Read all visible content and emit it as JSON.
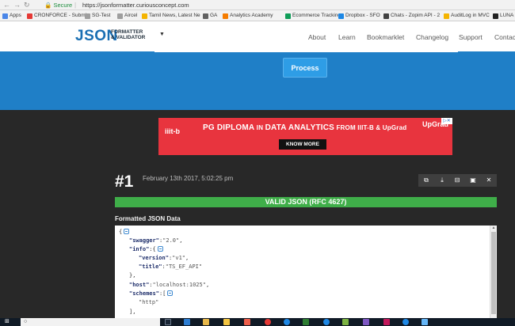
{
  "browser": {
    "secure_label": "Secure",
    "url": "https://jsonformatter.curiousconcept.com",
    "bookmarks": [
      {
        "label": "Apps",
        "color": "#4a86e8"
      },
      {
        "label": "CRONFORCE - Submi",
        "color": "#e53935"
      },
      {
        "label": "SG-Test",
        "color": "#9e9e9e"
      },
      {
        "label": "Aircel",
        "color": "#9e9e9e"
      },
      {
        "label": "Tamil News, Latest Ne",
        "color": "#f4b400"
      },
      {
        "label": "GA",
        "color": "#616161"
      },
      {
        "label": "Analytics Academy",
        "color": "#f57c00"
      },
      {
        "label": "Ecommerce Tracking",
        "color": "#0f9d58"
      },
      {
        "label": "Dropbox - SFO",
        "color": "#1e88e5"
      },
      {
        "label": "Chats - Zopim API - 2",
        "color": "#424242"
      },
      {
        "label": "AuditLog in MVC",
        "color": "#f4b400"
      },
      {
        "label": "LUNA",
        "color": "#212121"
      }
    ]
  },
  "header": {
    "logo": "JSON",
    "logo_sub_1": "FORMATTER",
    "logo_sub_2": "& VALIDATOR",
    "nav": [
      "About",
      "Learn",
      "Bookmarklet",
      "Changelog",
      "Support",
      "Contac"
    ]
  },
  "process_button": "Process",
  "ad": {
    "logo": "iiit-b",
    "headline_1": "PG DIPLOMA",
    "headline_2": " IN ",
    "headline_3": "DATA ANALYTICS",
    "headline_4": " FROM IIIT-B & UpGrad",
    "brand": "UpGrad",
    "cta": "KNOW MORE"
  },
  "result": {
    "number": "#1",
    "date": "February 13th 2017, 5:02:25 pm",
    "valid_label": "VALID JSON (RFC 4627)",
    "formatted_label": "Formatted JSON Data"
  },
  "colors": {
    "blue_band": "#1f7fc7",
    "valid_green": "#3fae49",
    "ad_red": "#e8343e"
  }
}
